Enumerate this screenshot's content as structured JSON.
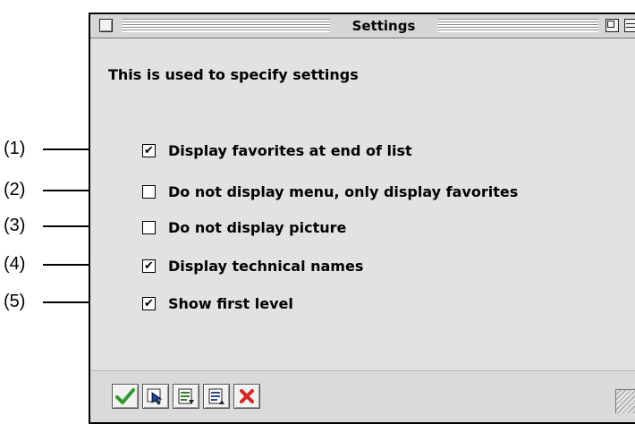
{
  "window": {
    "title": "Settings",
    "description": "This is used to specify settings"
  },
  "options": [
    {
      "label": "Display favorites at end of list",
      "checked": true
    },
    {
      "label": "Do not display menu, only display favorites",
      "checked": false
    },
    {
      "label": "Do not display picture",
      "checked": false
    },
    {
      "label": "Display technical names",
      "checked": true
    },
    {
      "label": "Show first level",
      "checked": true
    }
  ],
  "callouts": [
    "(1)",
    "(2)",
    "(3)",
    "(4)",
    "(5)"
  ],
  "toolbar": {
    "buttons": [
      {
        "icon": "checkmark-icon",
        "color": "#2e9b2e"
      },
      {
        "icon": "select-pointer-icon",
        "color": "#1a44a8"
      },
      {
        "icon": "save-document-icon",
        "color": "#3a7f2e"
      },
      {
        "icon": "load-document-icon",
        "color": "#2a4a9a"
      },
      {
        "icon": "cancel-x-icon",
        "color": "#d8251d"
      }
    ]
  }
}
